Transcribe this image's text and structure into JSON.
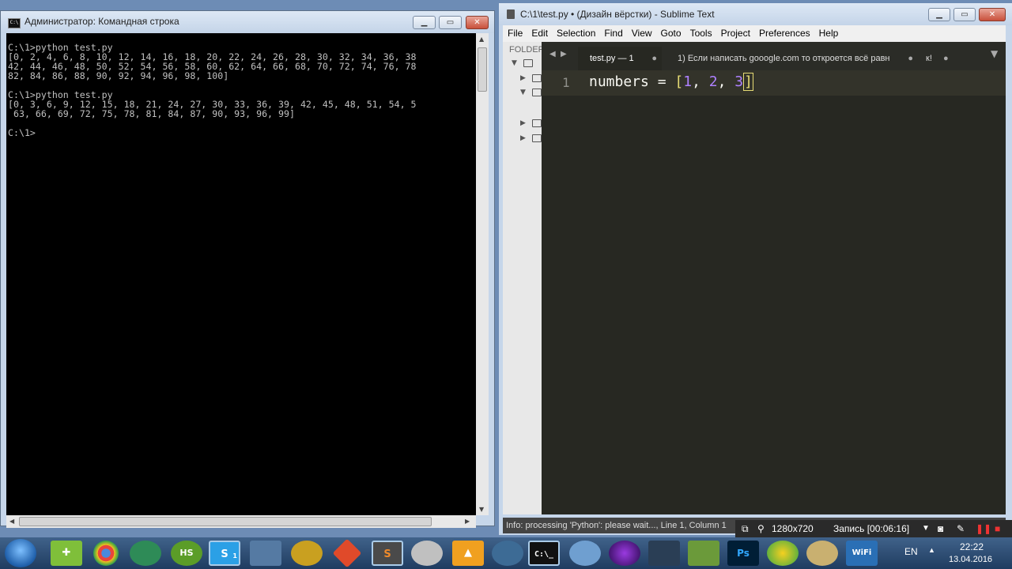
{
  "cmd": {
    "title": "Администратор: Командная строка",
    "icon": "cmd-icon",
    "output": "C:\\1>python test.py\n[0, 2, 4, 6, 8, 10, 12, 14, 16, 18, 20, 22, 24, 26, 28, 30, 32, 34, 36, 38\n42, 44, 46, 48, 50, 52, 54, 56, 58, 60, 62, 64, 66, 68, 70, 72, 74, 76, 78\n82, 84, 86, 88, 90, 92, 94, 96, 98, 100]\n\nC:\\1>python test.py\n[0, 3, 6, 9, 12, 15, 18, 21, 24, 27, 30, 33, 36, 39, 42, 45, 48, 51, 54, 5\n 63, 66, 69, 72, 75, 78, 81, 84, 87, 90, 93, 96, 99]\n\nC:\\1>"
  },
  "sublime": {
    "title": "C:\\1\\test.py • (Дизайн вёрстки) - Sublime Text",
    "menu": [
      "File",
      "Edit",
      "Selection",
      "Find",
      "View",
      "Goto",
      "Tools",
      "Project",
      "Preferences",
      "Help"
    ],
    "sidebar_header": "FOLDERS",
    "tabs": [
      {
        "label": "test.py — 1",
        "active": true
      },
      {
        "label": "1) Если написать gooogle.com то откроется всё равн",
        "active": false
      },
      {
        "label": "к!",
        "active": false
      }
    ],
    "line_number": "1",
    "code": {
      "ident": "numbers",
      "op": " = ",
      "open": "[",
      "n1": "1",
      "sep1": ", ",
      "n2": "2",
      "sep2": ", ",
      "n3": "3",
      "close": "]"
    },
    "status": "Info: processing 'Python': please wait..., Line 1, Column 1"
  },
  "recorder": {
    "resolution": "1280x720",
    "recording": "Запись [00:06:16]"
  },
  "taskbar": {
    "lang": "EN",
    "time": "22:22",
    "date": "13.04.2016",
    "apps": [
      "start-button",
      "green-app-icon",
      "chrome-icon",
      "globe-icon",
      "hs-icon",
      "skype-icon",
      "app-icon",
      "app-icon",
      "git-icon",
      "sublime-icon",
      "app-icon",
      "app-icon",
      "app-icon",
      "cmd-icon",
      "app-icon",
      "app-icon",
      "app-icon",
      "app-icon",
      "photoshop-icon",
      "app-icon",
      "app-icon",
      "wifi-icon"
    ],
    "skype_badge": "1"
  }
}
